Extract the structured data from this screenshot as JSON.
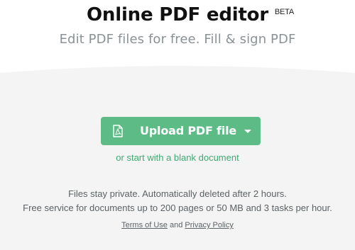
{
  "header": {
    "title": "Online PDF editor",
    "beta": "BETA",
    "subtitle": "Edit PDF files for free. Fill & sign PDF"
  },
  "upload": {
    "label": "Upload PDF file",
    "icon": "pdf-file-icon",
    "color": "#5dbb85"
  },
  "blank_link": "or start with a blank document",
  "info": {
    "line1": "Files stay private. Automatically deleted after 2 hours.",
    "line2": "Free service for documents up to 200 pages or 50 MB and 3 tasks per hour."
  },
  "footer": {
    "terms": "Terms of Use",
    "and": "and",
    "privacy": "Privacy Policy"
  },
  "colors": {
    "accent": "#3daa72",
    "background_curve": "#f4f4f4"
  }
}
